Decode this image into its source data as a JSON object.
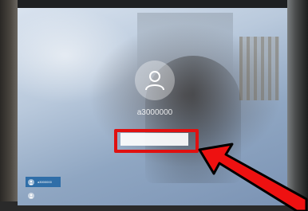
{
  "lock_screen": {
    "username": "a3000000",
    "password_placeholder": "",
    "other_users": [
      {
        "label": "a3000000",
        "active": true
      },
      {
        "label": "",
        "active": false
      }
    ]
  },
  "colors": {
    "highlight": "#e01010",
    "arrow": "#ee1111",
    "active_user": "#2f6ea8"
  },
  "icons": {
    "avatar": "user-silhouette-icon",
    "annotation": "red-arrow-icon"
  }
}
